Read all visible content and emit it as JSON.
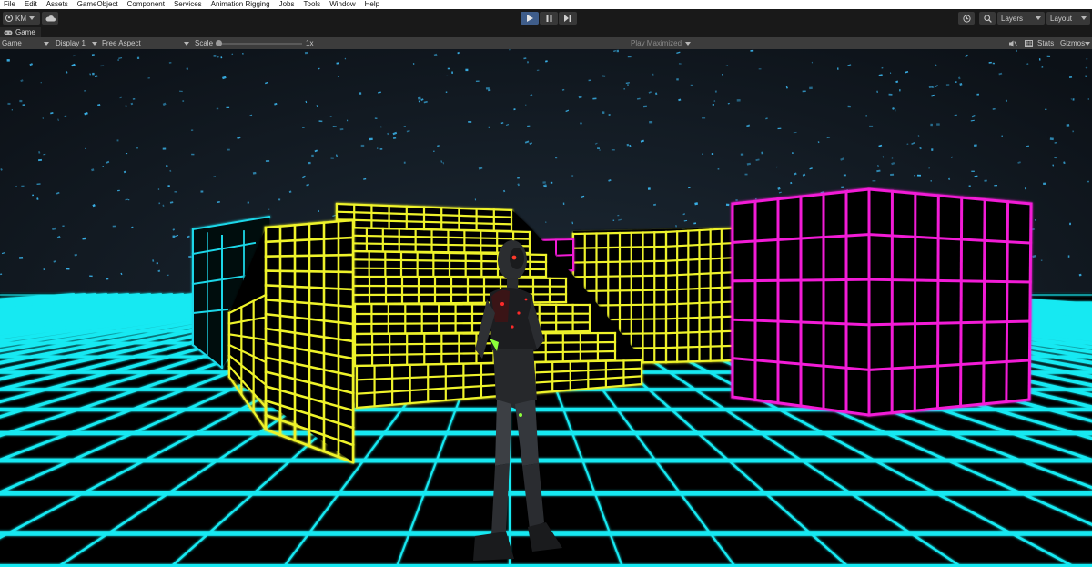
{
  "menu": [
    "File",
    "Edit",
    "Assets",
    "GameObject",
    "Component",
    "Services",
    "Animation Rigging",
    "Jobs",
    "Tools",
    "Window",
    "Help"
  ],
  "toolbar": {
    "account_label": "KM",
    "layers_label": "Layers",
    "layout_label": "Layout",
    "play_active_color": "#3f5d8a"
  },
  "tab": {
    "label": "Game"
  },
  "gamebar": {
    "mode_label": "Game",
    "display_label": "Display 1",
    "aspect_label": "Free Aspect",
    "scale_label": "Scale",
    "scale_value": "1x",
    "scale_fraction": 0.0,
    "play_maximized_label": "Play Maximized",
    "stats_label": "Stats",
    "gizmos_label": "Gizmos"
  },
  "scene": {
    "floor_color": "#19e9f2",
    "left_block_color": "#1bd7e8",
    "yellow_color": "#eef22a",
    "magenta_color": "#f21ad6",
    "sky_color": "#121a22",
    "star_color": "#3ab3ea"
  }
}
